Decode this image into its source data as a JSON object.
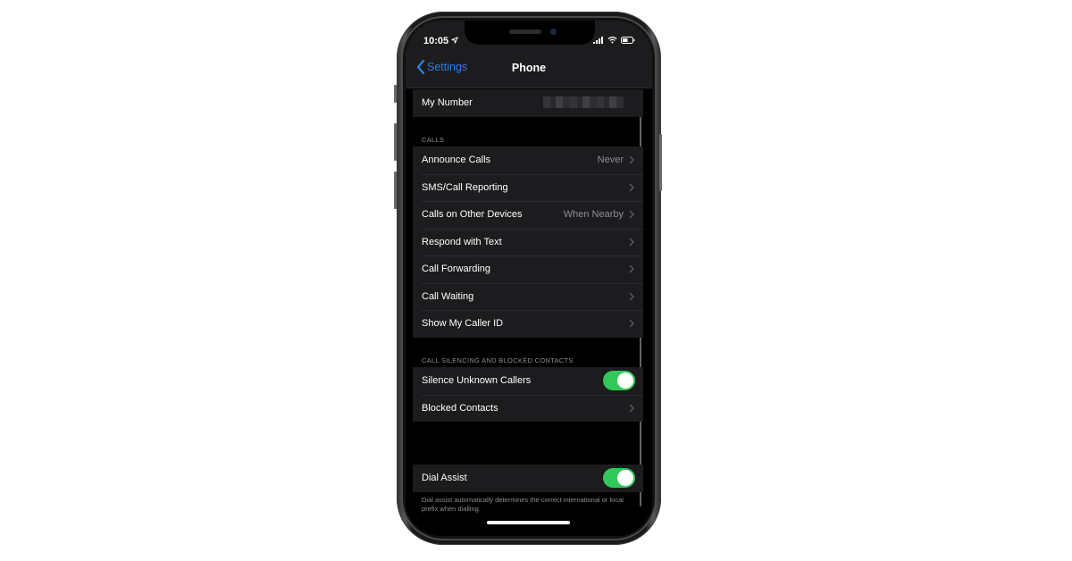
{
  "status_bar": {
    "time": "10:05",
    "icons": [
      "location-arrow-icon",
      "cellular-signal-icon",
      "wifi-icon",
      "battery-icon"
    ]
  },
  "nav": {
    "back_label": "Settings",
    "title": "Phone"
  },
  "my_number": {
    "label": "My Number",
    "value_redacted": true
  },
  "sections": {
    "calls": {
      "header": "CALLS",
      "rows": [
        {
          "label": "Announce Calls",
          "value": "Never"
        },
        {
          "label": "SMS/Call Reporting",
          "value": ""
        },
        {
          "label": "Calls on Other Devices",
          "value": "When Nearby"
        },
        {
          "label": "Respond with Text",
          "value": ""
        },
        {
          "label": "Call Forwarding",
          "value": ""
        },
        {
          "label": "Call Waiting",
          "value": ""
        },
        {
          "label": "Show My Caller ID",
          "value": ""
        }
      ]
    },
    "silencing": {
      "header": "CALL SILENCING AND BLOCKED CONTACTS",
      "rows": [
        {
          "label": "Silence Unknown Callers",
          "toggle": true
        },
        {
          "label": "Blocked Contacts"
        }
      ]
    },
    "dial_assist": {
      "label": "Dial Assist",
      "toggle": true,
      "footer": "Dial assist automatically determines the correct international or local prefix when dialling."
    }
  },
  "colors": {
    "accent": "#2f7fe0",
    "toggle_on": "#34c759",
    "cell_bg": "#1c1c1e",
    "secondary_text": "#8e8e93"
  }
}
